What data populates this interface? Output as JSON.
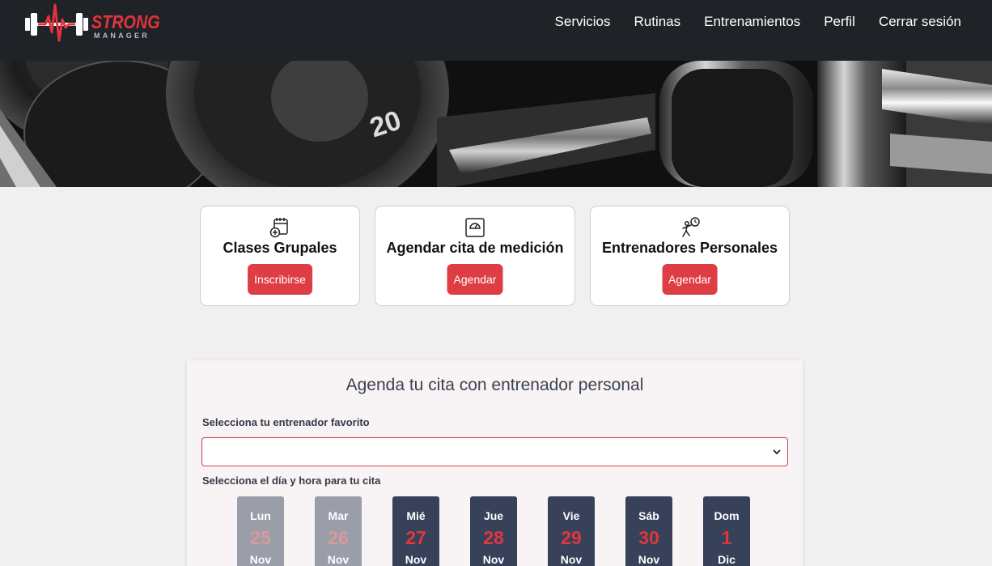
{
  "brand": {
    "name": "STRONG",
    "subtitle": "MANAGER",
    "accent": "#e1343d"
  },
  "nav": {
    "items": [
      {
        "label": "Servicios"
      },
      {
        "label": "Rutinas"
      },
      {
        "label": "Entrenamientos"
      },
      {
        "label": "Perfil"
      },
      {
        "label": "Cerrar sesión"
      }
    ]
  },
  "hero": {
    "icon": "dumbbell-weights-photo",
    "plate_number": "20"
  },
  "cards": [
    {
      "title": "Clases Grupales",
      "button": "Inscribirse",
      "icon": "calendar-add-icon"
    },
    {
      "title": "Agendar cita de medición",
      "button": "Agendar",
      "icon": "scale-icon"
    },
    {
      "title": "Entrenadores Personales",
      "button": "Agendar",
      "icon": "trainer-icon"
    }
  ],
  "appointment": {
    "title": "Agenda tu cita con entrenador personal",
    "trainer_label": "Selecciona tu entrenador favorito",
    "trainer_value": "",
    "date_label": "Selecciona el día y hora para tu cita",
    "days": [
      {
        "name": "Lun",
        "number": "25",
        "month": "Nov",
        "status": "past"
      },
      {
        "name": "Mar",
        "number": "26",
        "month": "Nov",
        "status": "past"
      },
      {
        "name": "Mié",
        "number": "27",
        "month": "Nov",
        "status": "available"
      },
      {
        "name": "Jue",
        "number": "28",
        "month": "Nov",
        "status": "available"
      },
      {
        "name": "Vie",
        "number": "29",
        "month": "Nov",
        "status": "available"
      },
      {
        "name": "Sáb",
        "number": "30",
        "month": "Nov",
        "status": "available"
      },
      {
        "name": "Dom",
        "number": "1",
        "month": "Dic",
        "status": "available"
      }
    ]
  },
  "colors": {
    "header_bg": "#1f2227",
    "button_red": "#de3d44",
    "day_available": "#37415a",
    "day_past": "#9a9ea8"
  }
}
